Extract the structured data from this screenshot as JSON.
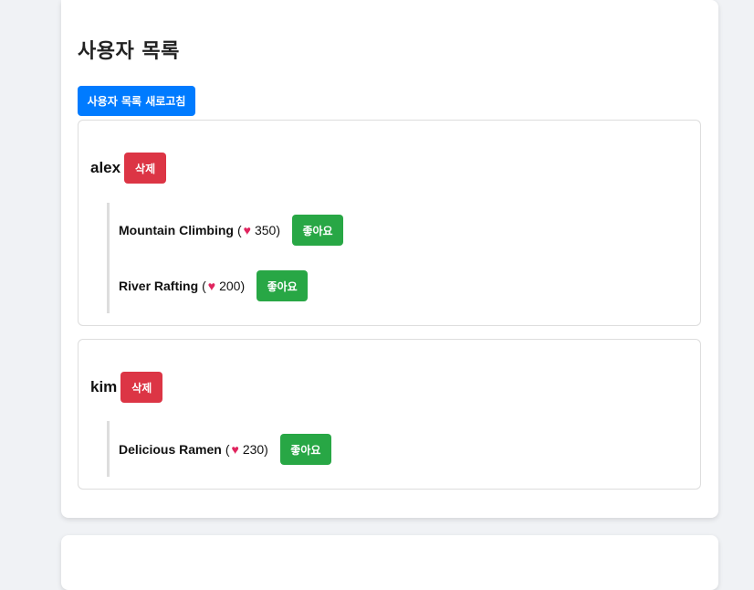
{
  "page": {
    "title": "사용자 목록",
    "refresh_label": "사용자 목록 새로고침"
  },
  "users": [
    {
      "name": "alex",
      "delete_label": "삭제",
      "posts": [
        {
          "title": "Mountain Climbing",
          "likes": "350",
          "like_label": "좋아요"
        },
        {
          "title": "River Rafting",
          "likes": "200",
          "like_label": "좋아요"
        }
      ]
    },
    {
      "name": "kim",
      "delete_label": "삭제",
      "posts": [
        {
          "title": "Delicious Ramen",
          "likes": "230",
          "like_label": "좋아요"
        }
      ]
    }
  ],
  "icons": {
    "like": "heart-icon"
  },
  "colors": {
    "primary": "#007bff",
    "danger": "#dc3545",
    "success": "#28a745",
    "heart": "#e0245e"
  }
}
